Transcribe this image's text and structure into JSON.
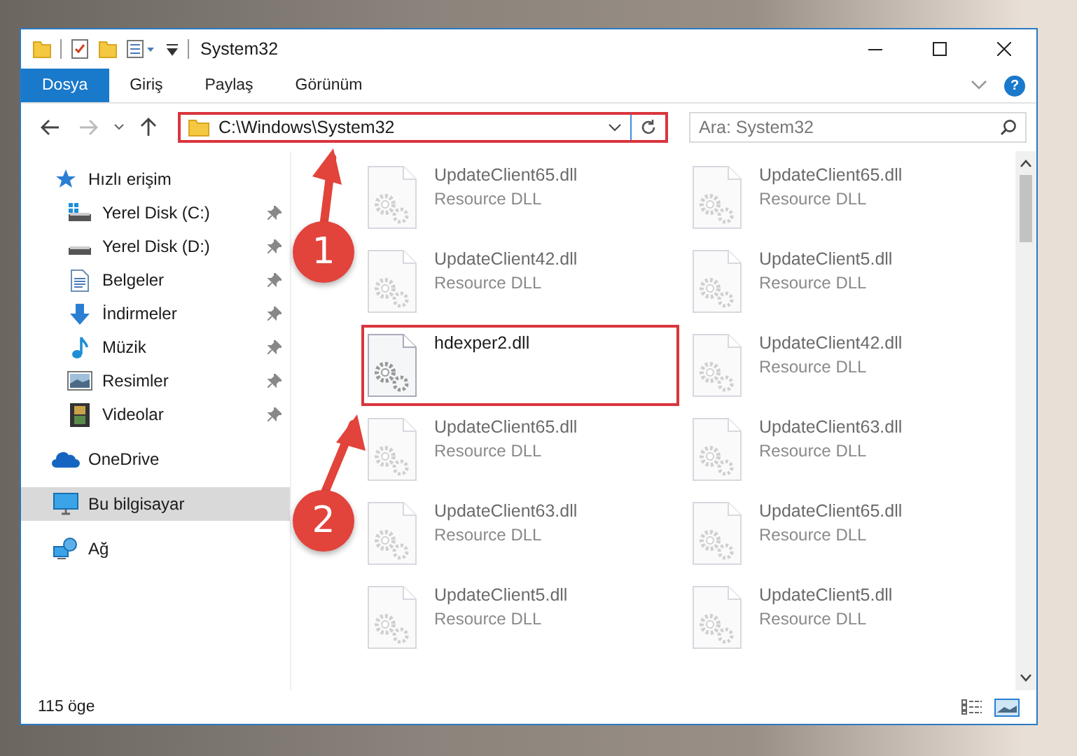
{
  "window": {
    "title": "System32"
  },
  "ribbon": {
    "tabs": [
      {
        "label": "Dosya",
        "selected": true
      },
      {
        "label": "Giriş",
        "selected": false
      },
      {
        "label": "Paylaş",
        "selected": false
      },
      {
        "label": "Görünüm",
        "selected": false
      }
    ],
    "help_button": "?"
  },
  "address_bar": {
    "path": "C:\\Windows\\System32",
    "highlighted": true
  },
  "search": {
    "placeholder": "Ara: System32"
  },
  "sidebar": {
    "items": [
      {
        "label": "Hızlı erişim",
        "kind": "star",
        "selected": false,
        "children": [
          {
            "label": "Yerel Disk (C:)",
            "kind": "drive-c",
            "pinned": true,
            "selected": false
          },
          {
            "label": "Yerel Disk (D:)",
            "kind": "drive",
            "pinned": true,
            "selected": false
          },
          {
            "label": "Belgeler",
            "kind": "document",
            "pinned": true,
            "selected": false
          },
          {
            "label": "İndirmeler",
            "kind": "download",
            "pinned": true,
            "selected": false
          },
          {
            "label": "Müzik",
            "kind": "music",
            "pinned": true,
            "selected": false
          },
          {
            "label": "Resimler",
            "kind": "pictures",
            "pinned": true,
            "selected": false
          },
          {
            "label": "Videolar",
            "kind": "videos",
            "pinned": true,
            "selected": false
          }
        ]
      },
      {
        "label": "OneDrive",
        "kind": "cloud",
        "selected": false
      },
      {
        "label": "Bu bilgisayar",
        "kind": "computer",
        "selected": true
      },
      {
        "label": "Ağ",
        "kind": "network",
        "selected": false
      }
    ]
  },
  "files": [
    {
      "name": "UpdateClient65.dll",
      "type": "Resource DLL",
      "highlighted": false
    },
    {
      "name": "UpdateClient65.dll",
      "type": "Resource DLL",
      "highlighted": false
    },
    {
      "name": "UpdateClient42.dll",
      "type": "Resource DLL",
      "highlighted": false
    },
    {
      "name": "UpdateClient5.dll",
      "type": "Resource DLL",
      "highlighted": false
    },
    {
      "name": "hdexper2.dll",
      "highlighted": true
    },
    {
      "name": "UpdateClient42.dll",
      "type": "Resource DLL",
      "highlighted": false
    },
    {
      "name": "UpdateClient65.dll",
      "type": "Resource DLL",
      "highlighted": false
    },
    {
      "name": "UpdateClient63.dll",
      "type": "Resource DLL",
      "highlighted": false
    },
    {
      "name": "UpdateClient63.dll",
      "type": "Resource DLL",
      "highlighted": false
    },
    {
      "name": "UpdateClient65.dll",
      "type": "Resource DLL",
      "highlighted": false
    },
    {
      "name": "UpdateClient5.dll",
      "type": "Resource DLL",
      "highlighted": false
    },
    {
      "name": "UpdateClient5.dll",
      "type": "Resource DLL",
      "highlighted": false
    }
  ],
  "status_bar": {
    "count": "115 öge"
  },
  "annotations": [
    {
      "number": "1"
    },
    {
      "number": "2"
    }
  ]
}
